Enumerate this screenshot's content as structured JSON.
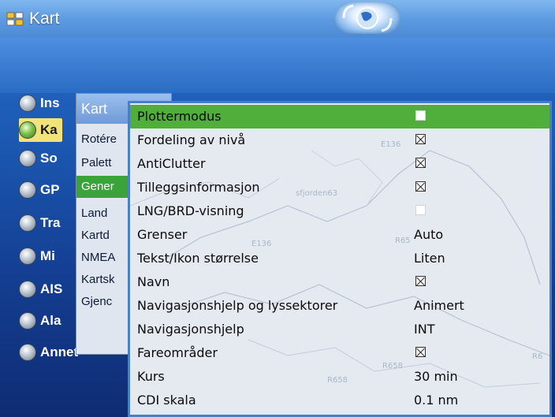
{
  "header": {
    "title": "Kart"
  },
  "main_menu": [
    {
      "label": "Ins",
      "icon": "gear-icon"
    },
    {
      "label": "Ka",
      "icon": "globe-icon",
      "active": true
    },
    {
      "label": "So",
      "icon": "sonar-icon"
    },
    {
      "label": "GP",
      "icon": "satellite-icon"
    },
    {
      "label": "Tra",
      "icon": "track-icon"
    },
    {
      "label": "Mi",
      "icon": "waypoint-icon"
    },
    {
      "label": "AIS",
      "icon": "ais-icon"
    },
    {
      "label": "Ala",
      "icon": "alarm-icon"
    },
    {
      "label": "Annet",
      "icon": "other-icon"
    }
  ],
  "submenu": {
    "title": "Kart",
    "items": [
      "Rotére",
      "Palett",
      "Gener",
      "Land",
      "Kartd",
      "NMEA",
      "Kartsk",
      "Gjenc"
    ],
    "active_index": 2
  },
  "settings": [
    {
      "label": "Plottermodus",
      "type": "checkbox",
      "checked": false,
      "selected": true
    },
    {
      "label": "Fordeling av nivå",
      "type": "checkbox",
      "checked": true
    },
    {
      "label": "AntiClutter",
      "type": "checkbox",
      "checked": true
    },
    {
      "label": "Tilleggsinformasjon",
      "type": "checkbox",
      "checked": true
    },
    {
      "label": "LNG/BRD-visning",
      "type": "checkbox",
      "checked": false
    },
    {
      "label": "Grenser",
      "type": "value",
      "value": "Auto"
    },
    {
      "label": "Tekst/Ikon størrelse",
      "type": "value",
      "value": "Liten"
    },
    {
      "label": "Navn",
      "type": "checkbox",
      "checked": true
    },
    {
      "label": "Navigasjonshjelp og lyssektorer",
      "type": "value",
      "value": "Animert"
    },
    {
      "label": "Navigasjonshjelp",
      "type": "value",
      "value": "INT"
    },
    {
      "label": "Fareområder",
      "type": "checkbox",
      "checked": true
    },
    {
      "label": "Kurs",
      "type": "value",
      "value": "30 min"
    },
    {
      "label": "CDI skala",
      "type": "value",
      "value": "0.1 nm"
    }
  ],
  "map_labels": [
    "E136",
    "sfjorden63",
    "R65",
    "E136",
    "R658",
    "R658",
    "R6"
  ],
  "colors": {
    "selected_row": "#4faf3a",
    "active_submenu": "#3aa33a",
    "active_mainmenu": "#f2e27a",
    "panel_border": "#4a7ec8"
  }
}
